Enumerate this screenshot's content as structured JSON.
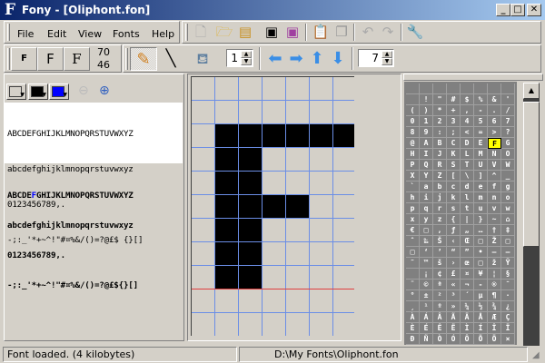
{
  "window": {
    "title": "Fony - [Oliphont.fon]",
    "app_icon": "F",
    "buttons": [
      "_",
      "□",
      "✕"
    ]
  },
  "menu": [
    "File",
    "Edit",
    "View",
    "Fonts",
    "Help"
  ],
  "toolbar1": [
    "new-file-icon",
    "open-folder-icon",
    "open-recent-icon",
    "save-icon",
    "save-as-icon",
    "paste-icon",
    "copy-icon",
    "undo-icon",
    "redo-icon",
    "settings-wrench-icon"
  ],
  "toolbar2": {
    "font_size_buttons": [
      "F",
      "F",
      "F"
    ],
    "char_code_dec": "70",
    "char_code_hex": "46",
    "tools": [
      "pencil-icon",
      "line-icon",
      "fill-bucket-icon"
    ],
    "pen_size": "1",
    "arrows": [
      "shift-left-icon",
      "shift-right-icon",
      "shift-up-icon",
      "shift-down-icon"
    ],
    "char_width": "7"
  },
  "preview": {
    "lines": [
      "ABCDEFGHIJKLMNOPQRSTUVWXYZ",
      "abcdefghijklmnopqrstuvwxyz",
      "0123456789,.",
      "-;:_'*+~^!\"#¤%&/()=?@£$ {}[]"
    ],
    "font_lines": [
      {
        "pre": "ABCDE",
        "hl": "F",
        "post": "GHIJKLMNOPQRSTUVWXYZ"
      },
      "abcdefghijklmnopqrstuvwxyz",
      "0123456789,.",
      "-;:_'*+~^!\"#¤%&/()=?@£${}[]"
    ],
    "colors": {
      "background": "#d4d0c8",
      "foreground": "#000000",
      "highlight": "#0000ff"
    }
  },
  "glyph": {
    "char": "F",
    "width": 7,
    "height": 11,
    "baseline_row": 9,
    "bitmap": [
      "0000000",
      "0000000",
      "0111111",
      "0110000",
      "0110000",
      "0111100",
      "0110000",
      "0110000",
      "0110000",
      "0000000",
      "0000000"
    ]
  },
  "charmap": {
    "selected": "F",
    "rows": [
      [
        "",
        "",
        "",
        "",
        "",
        "",
        "",
        ""
      ],
      [
        " ",
        "!",
        "\"",
        "#",
        "$",
        "%",
        "&",
        "'"
      ],
      [
        "(",
        ")",
        "*",
        "+",
        ",",
        "-",
        ".",
        "/"
      ],
      [
        "0",
        "1",
        "2",
        "3",
        "4",
        "5",
        "6",
        "7"
      ],
      [
        "8",
        "9",
        ":",
        ";",
        "<",
        "=",
        ">",
        "?"
      ],
      [
        "@",
        "A",
        "B",
        "C",
        "D",
        "E",
        "F",
        "G"
      ],
      [
        "H",
        "I",
        "J",
        "K",
        "L",
        "M",
        "N",
        "O"
      ],
      [
        "P",
        "Q",
        "R",
        "S",
        "T",
        "U",
        "V",
        "W"
      ],
      [
        "X",
        "Y",
        "Z",
        "[",
        "\\",
        "]",
        "^",
        "_"
      ],
      [
        "`",
        "a",
        "b",
        "c",
        "d",
        "e",
        "f",
        "g"
      ],
      [
        "h",
        "i",
        "j",
        "k",
        "l",
        "m",
        "n",
        "o"
      ],
      [
        "p",
        "q",
        "r",
        "s",
        "t",
        "u",
        "v",
        "w"
      ],
      [
        "x",
        "y",
        "z",
        "{",
        "|",
        "}",
        "~",
        "⌂"
      ],
      [
        "€",
        "□",
        "‚",
        "ƒ",
        "„",
        "…",
        "†",
        "‡"
      ],
      [
        "ˆ",
        "‰",
        "Š",
        "‹",
        "Œ",
        "□",
        "Ž",
        "□"
      ],
      [
        "□",
        "‘",
        "’",
        "“",
        "”",
        "•",
        "–",
        "—"
      ],
      [
        "˜",
        "™",
        "š",
        "›",
        "œ",
        "□",
        "ž",
        "Ÿ"
      ],
      [
        " ",
        "¡",
        "¢",
        "£",
        "¤",
        "¥",
        "¦",
        "§"
      ],
      [
        "¨",
        "©",
        "ª",
        "«",
        "¬",
        "-",
        "®",
        "¯"
      ],
      [
        "°",
        "±",
        "²",
        "³",
        "´",
        "µ",
        "¶",
        "·"
      ],
      [
        "¸",
        "¹",
        "º",
        "»",
        "¼",
        "½",
        "¾",
        "¿"
      ],
      [
        "À",
        "Á",
        "Â",
        "Ã",
        "Ä",
        "Å",
        "Æ",
        "Ç"
      ],
      [
        "È",
        "É",
        "Ê",
        "Ë",
        "Ì",
        "Í",
        "Î",
        "Ï"
      ],
      [
        "Ð",
        "Ñ",
        "Ò",
        "Ó",
        "Ô",
        "Õ",
        "Ö",
        "×"
      ]
    ]
  },
  "status": {
    "message": "Font loaded. (4 kilobytes)",
    "path": "D:\\My Fonts\\Oliphont.fon"
  }
}
